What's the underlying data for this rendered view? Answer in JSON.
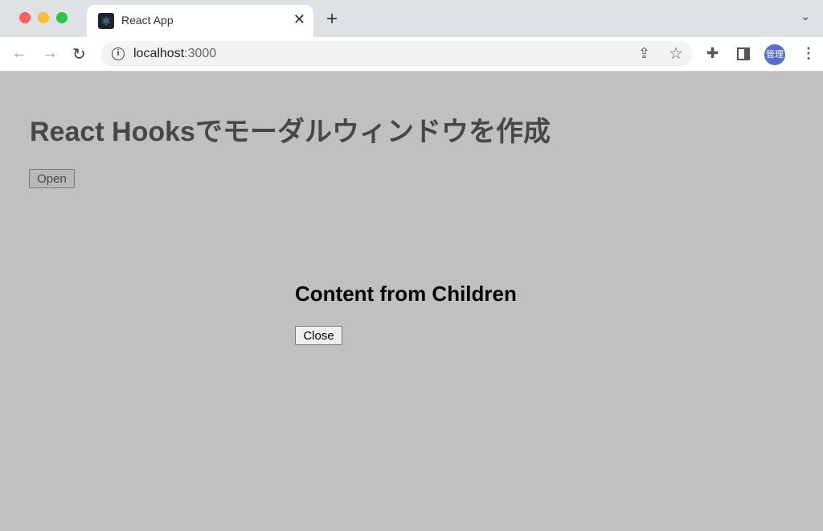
{
  "browser": {
    "tab_title": "React App",
    "url_host": "localhost",
    "url_port": ":3000",
    "profile_label": "管理",
    "colors": {
      "close": "#ff5f57",
      "minimize": "#febc2e",
      "maximize": "#28c840",
      "avatar": "#5b6bc9"
    }
  },
  "page": {
    "heading": "React Hooksでモーダルウィンドウを作成",
    "open_label": "Open",
    "overlay_color": "#c0c0c0"
  },
  "modal": {
    "title": "Content from Children",
    "close_label": "Close"
  }
}
